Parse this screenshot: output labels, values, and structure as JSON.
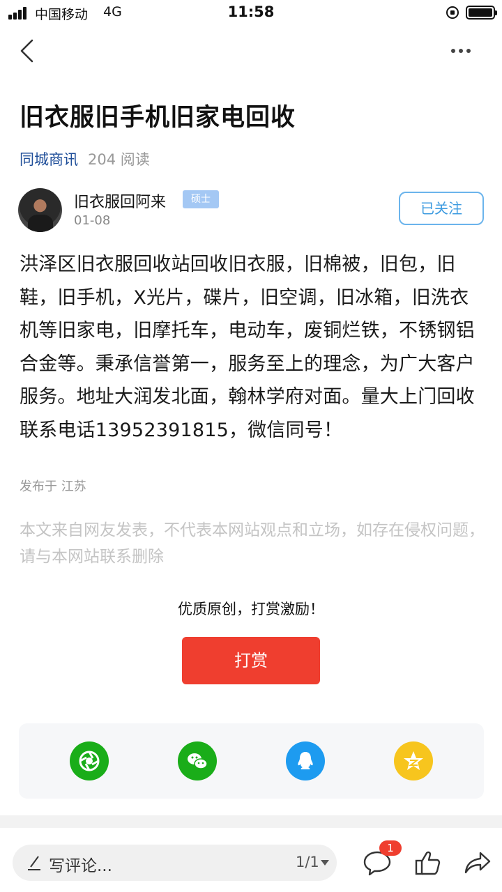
{
  "status_bar": {
    "carrier": "中国移动",
    "network": "4G",
    "time": "11:58"
  },
  "article": {
    "title": "旧衣服旧手机旧家电回收",
    "channel": "同城商讯",
    "read_count": "204 阅读",
    "author": {
      "name": "旧衣服回阿来",
      "badge": "硕士",
      "date": "01-08",
      "follow_label": "已关注"
    },
    "body": "洪泽区旧衣服回收站回收旧衣服，旧棉被，旧包，旧鞋，旧手机，X光片，碟片，旧空调，旧冰箱，旧洗衣机等旧家电，旧摩托车，电动车，废铜烂铁，不锈钢铝合金等。秉承信誉第一，服务至上的理念，为广大客户服务。地址大润发北面，翰林学府对面。量大上门回收联系电话13952391815，微信同号！",
    "location": "发布于 江苏",
    "disclaimer": "本文来自网友发表，不代表本网站观点和立场，如存在侵权问题，请与本网站联系删除"
  },
  "reward": {
    "prompt": "优质原创，打赏激励！",
    "button_label": "打赏"
  },
  "share_targets": [
    {
      "name": "moments-icon",
      "color": "#1aad19"
    },
    {
      "name": "wechat-icon",
      "color": "#1aad19"
    },
    {
      "name": "qq-icon",
      "color": "#1d9bf0"
    },
    {
      "name": "qzone-icon",
      "color": "#f7c51e"
    }
  ],
  "bottom_bar": {
    "comment_placeholder": "写评论...",
    "page_indicator": "1/1",
    "comment_count": "1"
  },
  "colors": {
    "accent_red": "#ef3e2f",
    "follow_blue": "#3d9be0",
    "channel_blue": "#1f4e99"
  }
}
